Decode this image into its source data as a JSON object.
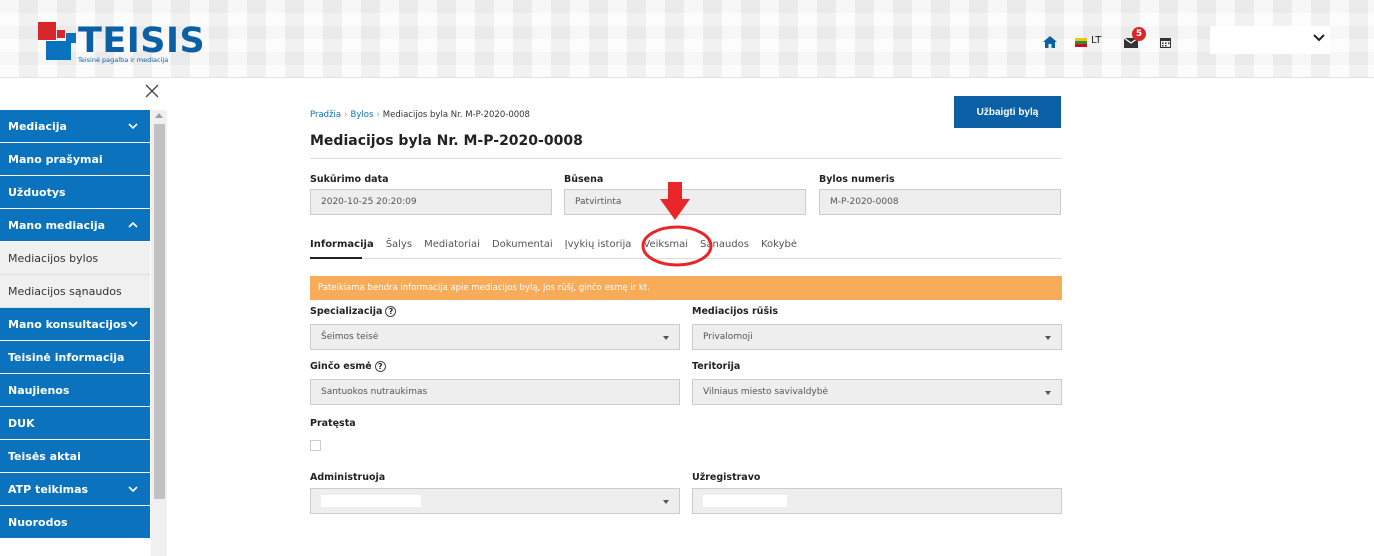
{
  "header": {
    "logo_text": "TEISIS",
    "logo_tagline": "Teisinė pagalba ir mediacija",
    "language": "LT",
    "notification_count": "5",
    "icons": [
      "home-icon",
      "flag-icon",
      "mail-icon",
      "calendar-icon",
      "chevron-down-icon"
    ],
    "colors": {
      "brand_blue": "#0b72bd",
      "brand_red": "#d9262a"
    }
  },
  "sidebar": {
    "close_icon": "close-icon",
    "items": [
      {
        "label": "Mediacija",
        "expandable": true
      },
      {
        "label": "Mano prašymai"
      },
      {
        "label": "Užduotys"
      },
      {
        "label": "Mano mediacija",
        "expandable": true
      },
      {
        "label": "Mediacijos bylos"
      },
      {
        "label": "Mediacijos sąnaudos"
      },
      {
        "label": "Mano konsultacijos",
        "expandable": true
      },
      {
        "label": "Teisinė informacija"
      },
      {
        "label": "Naujienos"
      },
      {
        "label": "DUK"
      },
      {
        "label": "Teisės aktai"
      },
      {
        "label": "ATP teikimas",
        "expandable": true
      },
      {
        "label": "Nuorodos"
      }
    ]
  },
  "breadcrumb": {
    "home": "Pradžia",
    "bylos": "Bylos",
    "current": "Mediacijos byla Nr. M-P-2020-0008",
    "separator": "›"
  },
  "page_title": "Mediacijos byla Nr. M-P-2020-0008",
  "finish_button": "Užbaigti bylą",
  "summary": {
    "created_label": "Sukūrimo data",
    "created_value": "2020-10-25 20:20:09",
    "status_label": "Būsena",
    "status_value": "Patvirtinta",
    "number_label": "Bylos numeris",
    "number_value": "M-P-2020-0008"
  },
  "tabs": [
    "Informacija",
    "Šalys",
    "Mediatoriai",
    "Dokumentai",
    "Įvykių istorija",
    "Veiksmai",
    "Sąnaudos",
    "Kokybė"
  ],
  "info_banner": "Pateikiama bendra informacija apie mediacijos bylą, jos rūšį, ginčo esmę ir kt.",
  "form": {
    "specialization_label": "Specializacija",
    "specialization_value": "Šeimos teisė",
    "type_label": "Mediacijos rūšis",
    "type_value": "Privalomoji",
    "dispute_label": "Ginčo esmė",
    "dispute_value": "Santuokos nutraukimas",
    "territory_label": "Teritorija",
    "territory_value": "Vilniaus miesto savivaldybė",
    "extended_label": "Pratęsta",
    "administers_label": "Administruoja",
    "registered_label": "Užregistravo",
    "help_mark": "?"
  },
  "annotation": {
    "color": "#e8262a"
  }
}
